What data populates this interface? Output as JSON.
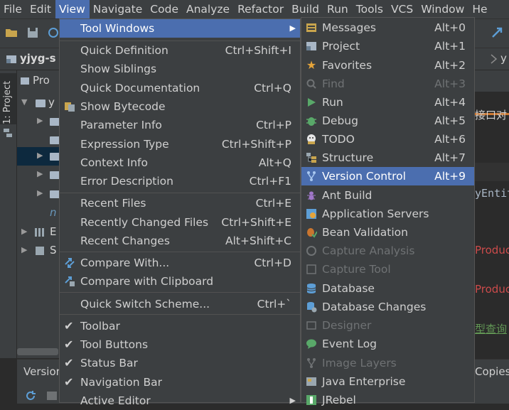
{
  "menubar": {
    "items": [
      "File",
      "Edit",
      "View",
      "Navigate",
      "Code",
      "Analyze",
      "Refactor",
      "Build",
      "Run",
      "Tools",
      "VCS",
      "Window",
      "He"
    ]
  },
  "navbar": {
    "crumb": "yjyg-s",
    "right_crumb": "y"
  },
  "left_strip": {
    "project_tab": "1: Project"
  },
  "project_panel": {
    "header": "Pro",
    "rows": [
      "y",
      "",
      "",
      "",
      "",
      "",
      "n",
      "E",
      "S"
    ]
  },
  "bottom_strip": {
    "title": "Versior",
    "right": "Copies"
  },
  "editor": {
    "lines": [
      "接口对",
      "yEntit",
      "Produc",
      "Produc",
      "型查询"
    ]
  },
  "view_menu": {
    "items": [
      {
        "label": "Tool Windows",
        "shortcut": "",
        "submenu": true
      },
      {
        "label": "Quick Definition",
        "shortcut": "Ctrl+Shift+I"
      },
      {
        "label": "Show Siblings",
        "shortcut": ""
      },
      {
        "label": "Quick Documentation",
        "shortcut": "Ctrl+Q"
      },
      {
        "label": "Show Bytecode",
        "shortcut": ""
      },
      {
        "label": "Parameter Info",
        "shortcut": "Ctrl+P"
      },
      {
        "label": "Expression Type",
        "shortcut": "Ctrl+Shift+P"
      },
      {
        "label": "Context Info",
        "shortcut": "Alt+Q"
      },
      {
        "label": "Error Description",
        "shortcut": "Ctrl+F1"
      },
      {
        "label": "Recent Files",
        "shortcut": "Ctrl+E"
      },
      {
        "label": "Recently Changed Files",
        "shortcut": "Ctrl+Shift+E"
      },
      {
        "label": "Recent Changes",
        "shortcut": "Alt+Shift+C"
      },
      {
        "label": "Compare With...",
        "shortcut": "Ctrl+D"
      },
      {
        "label": "Compare with Clipboard",
        "shortcut": ""
      },
      {
        "label": "Quick Switch Scheme...",
        "shortcut": "Ctrl+`"
      },
      {
        "label": "Toolbar",
        "shortcut": ""
      },
      {
        "label": "Tool Buttons",
        "shortcut": ""
      },
      {
        "label": "Status Bar",
        "shortcut": ""
      },
      {
        "label": "Navigation Bar",
        "shortcut": ""
      },
      {
        "label": "Active Editor",
        "shortcut": ""
      }
    ]
  },
  "tool_windows_menu": {
    "items": [
      {
        "label": "Messages",
        "shortcut": "Alt+0"
      },
      {
        "label": "Project",
        "shortcut": "Alt+1"
      },
      {
        "label": "Favorites",
        "shortcut": "Alt+2"
      },
      {
        "label": "Find",
        "shortcut": "Alt+3"
      },
      {
        "label": "Run",
        "shortcut": "Alt+4"
      },
      {
        "label": "Debug",
        "shortcut": "Alt+5"
      },
      {
        "label": "TODO",
        "shortcut": "Alt+6"
      },
      {
        "label": "Structure",
        "shortcut": "Alt+7"
      },
      {
        "label": "Version Control",
        "shortcut": "Alt+9"
      },
      {
        "label": "Ant Build",
        "shortcut": ""
      },
      {
        "label": "Application Servers",
        "shortcut": ""
      },
      {
        "label": "Bean Validation",
        "shortcut": ""
      },
      {
        "label": "Capture Analysis",
        "shortcut": ""
      },
      {
        "label": "Capture Tool",
        "shortcut": ""
      },
      {
        "label": "Database",
        "shortcut": ""
      },
      {
        "label": "Database Changes",
        "shortcut": ""
      },
      {
        "label": "Designer",
        "shortcut": ""
      },
      {
        "label": "Event Log",
        "shortcut": ""
      },
      {
        "label": "Image Layers",
        "shortcut": ""
      },
      {
        "label": "Java Enterprise",
        "shortcut": ""
      },
      {
        "label": "JRebel",
        "shortcut": ""
      }
    ]
  },
  "colors": {
    "menu_bg": "#3c3f41",
    "highlight": "#4b6eaf",
    "disabled_text": "#6f7274",
    "editor_red": "#cc4b4b"
  },
  "icons": {
    "messages": "messages-icon",
    "project": "project-icon",
    "favorites": "star-icon",
    "find": "find-icon",
    "run": "run-icon",
    "debug": "debug-icon",
    "todo": "todo-icon",
    "structure": "structure-icon",
    "version_control": "version-control-icon",
    "ant_build": "ant-icon",
    "app_servers": "app-servers-icon",
    "bean_validation": "bean-icon",
    "database": "database-icon",
    "database_changes": "database-changes-icon",
    "event_log": "event-log-icon",
    "java_enterprise": "java-enterprise-icon",
    "jrebel": "jrebel-icon"
  }
}
